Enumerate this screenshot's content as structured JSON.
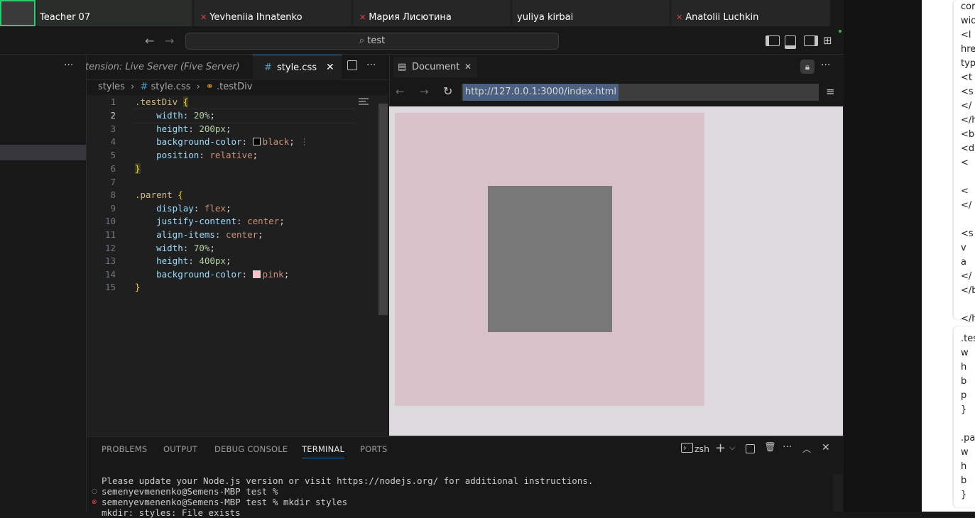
{
  "meeting": {
    "teacher": "Teacher 07",
    "participants": [
      "Yevheniia Ihnatenko",
      "Мария Лисютина",
      "yuliya kirbai",
      "Anatolii Luchkin"
    ]
  },
  "titlebar": {
    "search": "test"
  },
  "editor": {
    "tab_live_server": "tension: Live Server (Five Server)",
    "tab_active": "style.css",
    "breadcrumb": {
      "folder": "styles",
      "file": "style.css",
      "symbol": ".testDiv"
    },
    "line_numbers": [
      "1",
      "2",
      "3",
      "4",
      "5",
      "6",
      "7",
      "8",
      "9",
      "10",
      "11",
      "12",
      "13",
      "14",
      "15"
    ],
    "code": {
      "l1_sel": ".testDiv",
      "l1_br": "{",
      "l2_prop": "width",
      "l2_val": "20%",
      "l3_prop": "height",
      "l3_val": "200px",
      "l4_prop": "background-color",
      "l4_val": "black",
      "l5_prop": "position",
      "l5_val": "relative",
      "l6_br": "}",
      "l8_sel": ".parent",
      "l8_br": "{",
      "l9_prop": "display",
      "l9_val": "flex",
      "l10_prop": "justify-content",
      "l10_val": "center",
      "l11_prop": "align-items",
      "l11_val": "center",
      "l12_prop": "width",
      "l12_val": "70%",
      "l13_prop": "height",
      "l13_val": "400px",
      "l14_prop": "background-color",
      "l14_val": "pink",
      "l15_br": "}"
    }
  },
  "preview": {
    "tab": "Document",
    "url": "http://127.0.0.1:3000/index.html"
  },
  "panel": {
    "tabs": [
      "PROBLEMS",
      "OUTPUT",
      "DEBUG CONSOLE",
      "TERMINAL",
      "PORTS"
    ],
    "shell": "zsh",
    "terminal": [
      "Please update your Node.js version or visit https://nodejs.org/ for additional instructions.",
      "semenyevmenenko@Semens-MBP test %",
      "semenyevmenenko@Semens-MBP test % mkdir styles",
      "mkdir: styles: File exists"
    ]
  },
  "chat": {
    "block1": [
      "cor",
      "wid",
      "<l",
      "hre",
      "typ",
      "<t",
      "<s",
      "</",
      "</h",
      "<bo",
      "<d",
      "<",
      "",
      "<",
      "</",
      "",
      "<s",
      "v",
      "a",
      "</",
      "</b",
      "",
      "</h"
    ],
    "block2": [
      ".tes",
      "w",
      "h",
      "b",
      "p",
      "}",
      "",
      ".pa",
      "w",
      "h",
      "b",
      "}"
    ]
  }
}
